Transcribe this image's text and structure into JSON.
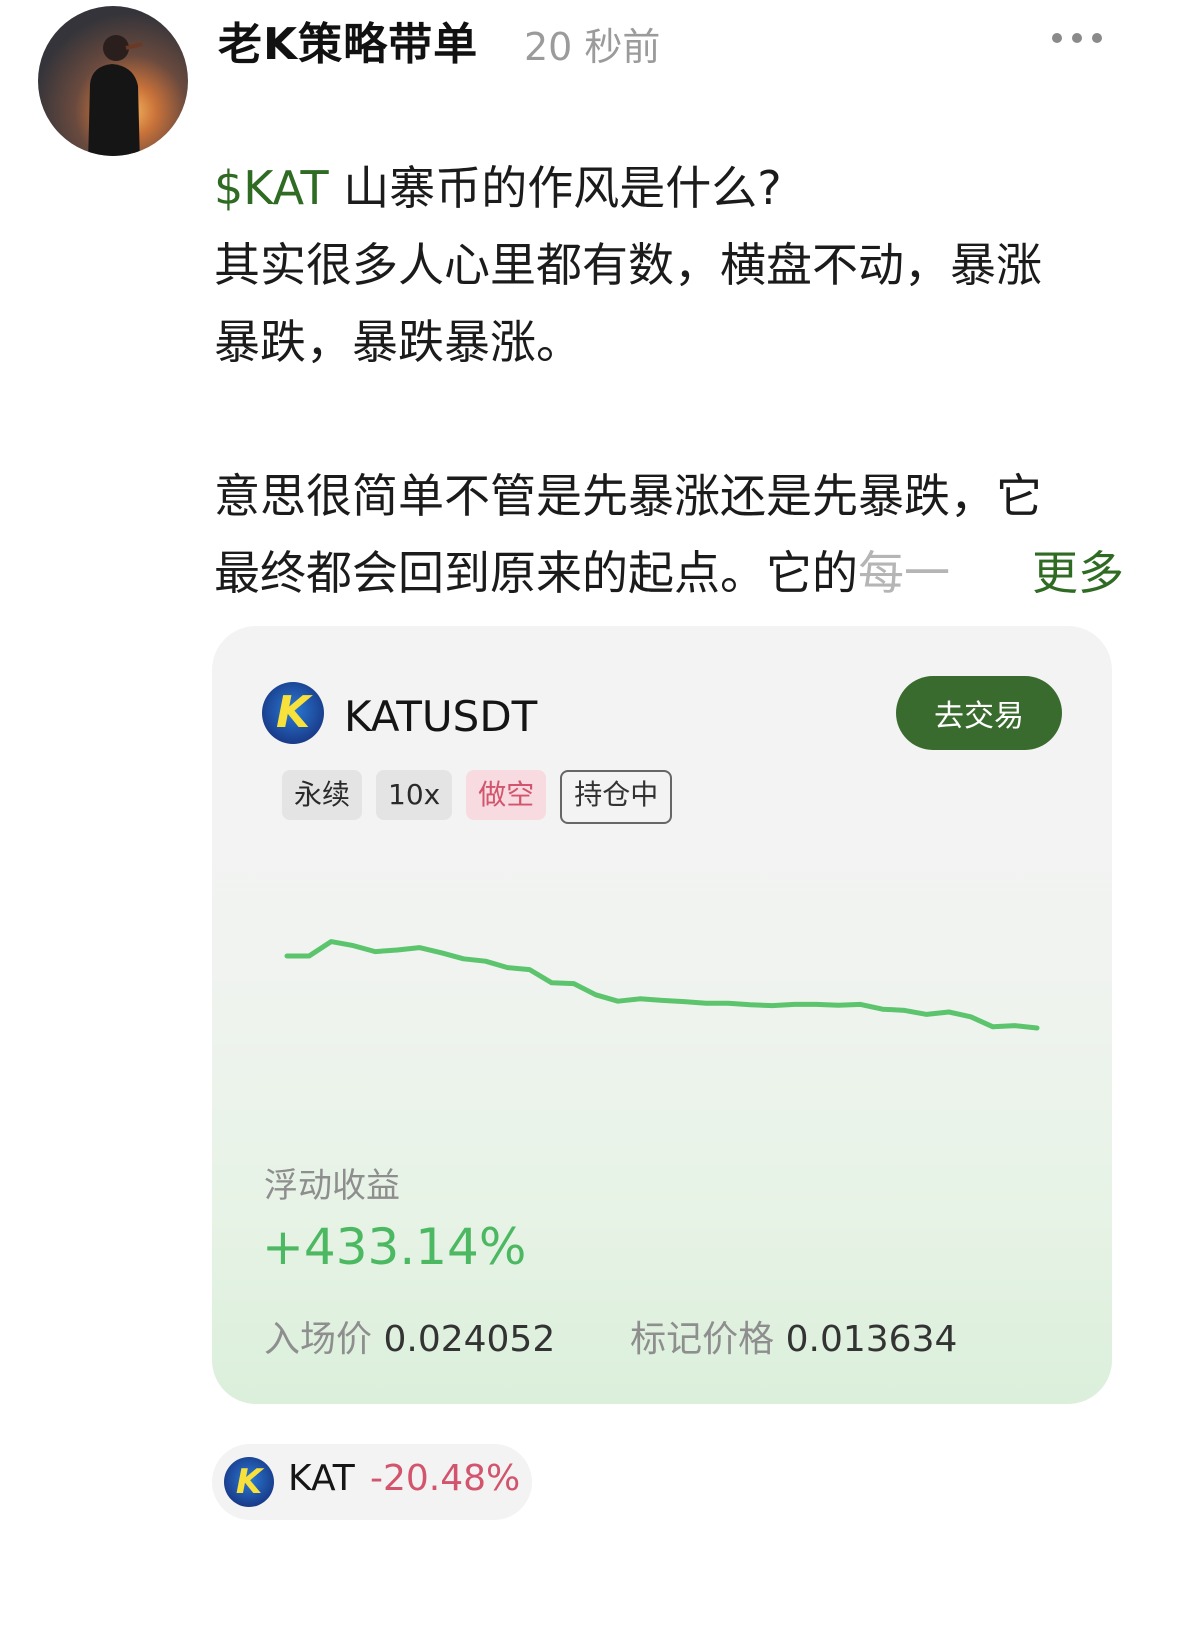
{
  "post": {
    "author": "老K策略带单",
    "time": "20 秒前",
    "cashtag": "$KAT",
    "line1_rest": " 山寨币的作风是什么?",
    "line2": "其实很多人心里都有数，横盘不动，暴涨",
    "line3": "暴跌，暴跌暴涨。",
    "line4": "意思很简单不管是先暴涨还是先暴跌，它",
    "line5_main": "最终都会回到原来的起点。它的",
    "line5_fade": "每一",
    "more_link": "更多"
  },
  "card": {
    "coin_logo_letter": "K",
    "pair": "KATUSDT",
    "trade_button": "去交易",
    "tags": [
      "永续",
      "10x",
      "做空",
      "持仓中"
    ],
    "sparkline": {
      "color": "#5cc46d",
      "values": [
        0.7,
        0.7,
        0.772,
        0.752,
        0.722,
        0.73,
        0.742,
        0.716,
        0.686,
        0.674,
        0.642,
        0.632,
        0.566,
        0.562,
        0.506,
        0.474,
        0.486,
        0.478,
        0.472,
        0.464,
        0.464,
        0.456,
        0.452,
        0.458,
        0.458,
        0.454,
        0.458,
        0.434,
        0.428,
        0.408,
        0.42,
        0.396,
        0.346,
        0.352,
        0.34
      ]
    },
    "pnl_label": "浮动收益",
    "pnl_value": "+433.14%",
    "entry_label": "入场价",
    "entry_value": "0.024052",
    "mark_label": "标记价格",
    "mark_value": "0.013634"
  },
  "ticker_chip": {
    "logo_letter": "K",
    "symbol": "KAT",
    "change": "-20.48%"
  },
  "colors": {
    "accent_green": "#2f6b23",
    "profit_green": "#4cb862",
    "loss_red": "#d2546d",
    "button_green": "#3a6b2e"
  },
  "icons": {
    "more": "ellipsis-icon",
    "coin": "kat-coin-icon"
  }
}
